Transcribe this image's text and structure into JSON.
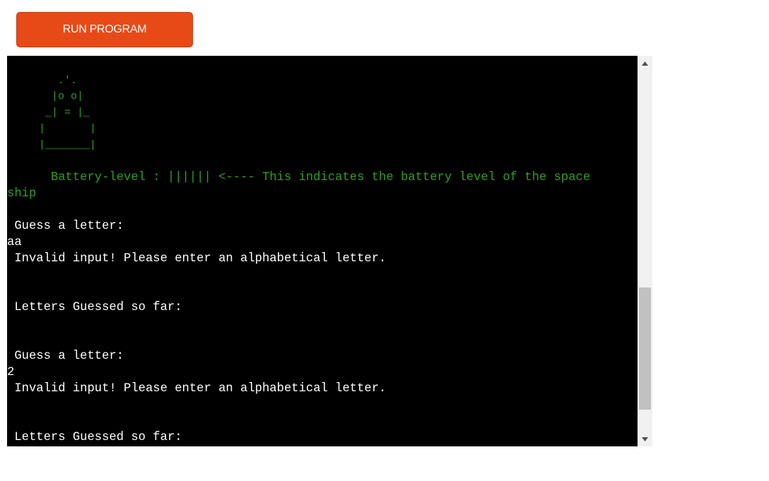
{
  "toolbar": {
    "run_label": "RUN PROGRAM"
  },
  "terminal": {
    "ascii_art": [
      "        .'.",
      "       |o o|",
      "      _| = |_",
      "     |       |",
      "     |_______|"
    ],
    "lines": [
      "      Battery-level : |||||| <---- This indicates the battery level of the space",
      "ship",
      " Guess a letter:",
      "aa",
      " Invalid input! Please enter an alphabetical letter.",
      " Letters Guessed so far:",
      " Guess a letter:",
      "2",
      " Invalid input! Please enter an alphabetical letter.",
      " Letters Guessed so far:"
    ]
  },
  "colors": {
    "accent": "#e84a17",
    "terminal_bg": "#000000",
    "green_text": "#2f9e24",
    "white_text": "#ffffff"
  },
  "scrollbar": {
    "up_icon": "triangle-up-icon",
    "down_icon": "triangle-down-icon"
  }
}
